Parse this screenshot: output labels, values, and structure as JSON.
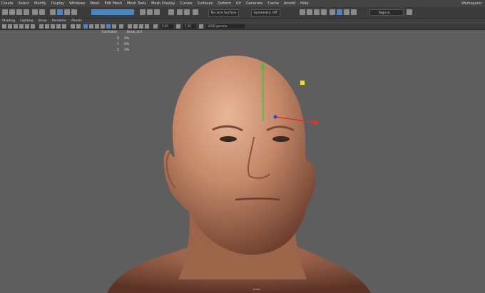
{
  "menu": {
    "items": [
      "Create",
      "Select",
      "Modify",
      "Display",
      "Windows",
      "Mesh",
      "Edit Mesh",
      "Mesh Tools",
      "Mesh Display",
      "Curves",
      "Surfaces",
      "Deform",
      "UV",
      "Generate",
      "Cache",
      "Arnold",
      "Help"
    ],
    "workspace": "Workspace:"
  },
  "toolbar": {
    "live_surface": "No Live Surface",
    "symmetry": "Symmetry: Off",
    "sign_in": "Sign in"
  },
  "panel_menu": {
    "items": [
      "Shading",
      "Lighting",
      "Show",
      "Renderer",
      "Panels"
    ]
  },
  "panel_toolbar": {
    "field1": "0.00",
    "field2": "1.00",
    "field3": "sRGB gamma"
  },
  "channel_box": {
    "header": "Controller:",
    "object": "Brow_ctrl",
    "rows": [
      {
        "label": "R",
        "value": "0%"
      },
      {
        "label": "Y",
        "value": "0%"
      },
      {
        "label": "Z",
        "value": "0%"
      }
    ]
  },
  "viewport": {
    "camera_label": "persp"
  }
}
